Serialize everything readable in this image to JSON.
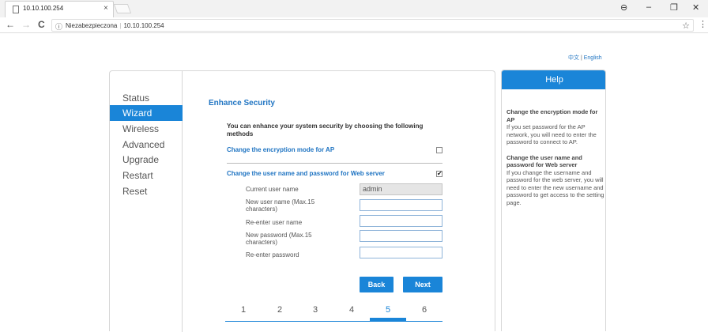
{
  "browser": {
    "tab_title": "10.10.100.254",
    "tab_close": "×",
    "back": "←",
    "forward": "→",
    "reload": "C",
    "security_label": "Niezabezpieczona",
    "url": "10.10.100.254",
    "star": "☆",
    "menu": "⋮",
    "profile": "⊖",
    "minimize": "–",
    "restore": "❐",
    "close": "✕",
    "info_icon": "ⓘ"
  },
  "lang": {
    "chinese": "中文",
    "separator": "|",
    "english": "English"
  },
  "sidebar": {
    "items": [
      {
        "label": "Status"
      },
      {
        "label": "Wizard"
      },
      {
        "label": "Wireless"
      },
      {
        "label": "Advanced"
      },
      {
        "label": "Upgrade"
      },
      {
        "label": "Restart"
      },
      {
        "label": "Reset"
      }
    ],
    "active": "Wizard"
  },
  "main": {
    "title": "Enhance Security",
    "intro": "You can enhance your system security by choosing the following methods",
    "option_encryption": "Change the encryption mode for AP",
    "option_encryption_checked": false,
    "option_credentials": "Change the user name and password for Web server",
    "option_credentials_checked": true,
    "check_mark": "✔",
    "fields": [
      {
        "label": "Current user name",
        "value": "admin"
      },
      {
        "label": "New user name (Max.15 characters)",
        "value": ""
      },
      {
        "label": "Re-enter user name",
        "value": ""
      },
      {
        "label": "New password (Max.15 characters)",
        "value": ""
      },
      {
        "label": "Re-enter password",
        "value": ""
      }
    ],
    "back_label": "Back",
    "next_label": "Next",
    "steps": [
      "1",
      "2",
      "3",
      "4",
      "5",
      "6"
    ],
    "current_step": "5"
  },
  "help": {
    "title": "Help",
    "section1_title": "Change the encryption mode for AP",
    "section1_text": "If you set password for the AP network, you will need to enter the password to connect to AP.",
    "section2_title": "Change the user name and password for Web server",
    "section2_text": "If you change the username and password for the web server, you will need to enter the new username and password to get access to the setting page."
  },
  "colors": {
    "accent": "#1a85d8",
    "link": "#1f74c2"
  }
}
